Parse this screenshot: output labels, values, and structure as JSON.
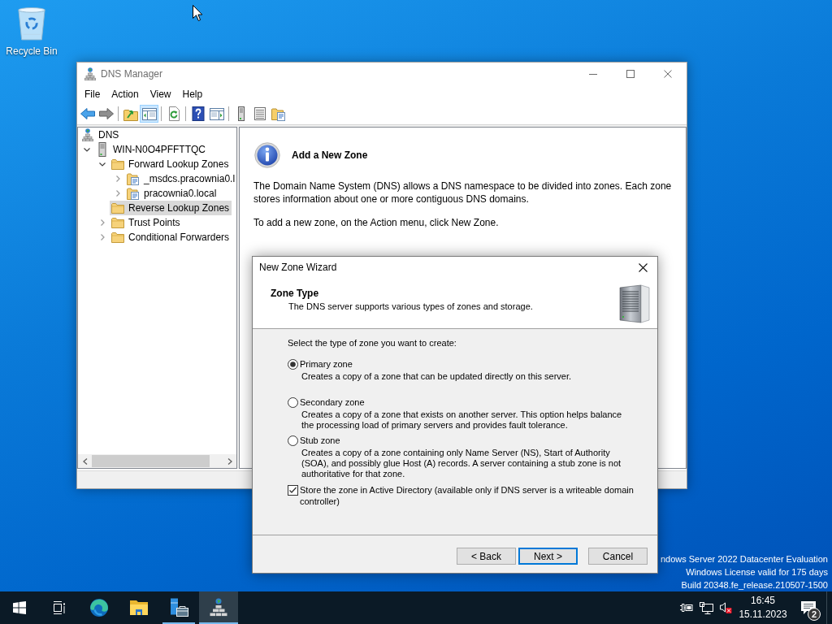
{
  "desktop": {
    "icons": [
      {
        "label": "Recycle Bin"
      }
    ],
    "edition_text": [
      "ndows Server 2022 Datacenter Evaluation",
      "Windows License valid for 175 days",
      "Build 20348.fe_release.210507-1500"
    ]
  },
  "dns_manager": {
    "title": "DNS Manager",
    "menu": [
      "File",
      "Action",
      "View",
      "Help"
    ],
    "toolbar": [
      [
        {
          "pressed": false
        },
        {
          "pressed": false
        }
      ],
      [
        {
          "pressed": false
        },
        {
          "pressed": true
        }
      ],
      [
        {
          "pressed": false
        }
      ],
      [
        {
          "pressed": false
        },
        {
          "pressed": false
        }
      ],
      [
        {
          "pressed": false
        },
        {
          "pressed": false
        },
        {
          "pressed": false
        }
      ]
    ],
    "tree": [
      {
        "label": "DNS",
        "kind": "dns",
        "selected": false,
        "children": [
          {
            "label": "WIN-N0O4PFFTTQC",
            "kind": "server",
            "expanded": true,
            "selected": false,
            "children": [
              {
                "label": "Forward Lookup Zones",
                "kind": "folder",
                "expanded": true,
                "selected": false,
                "children": [
                  {
                    "label": "_msdcs.pracownia0.l",
                    "kind": "zone",
                    "expanded": false,
                    "selected": false
                  },
                  {
                    "label": "pracownia0.local",
                    "kind": "zone",
                    "expanded": false,
                    "selected": false
                  }
                ]
              },
              {
                "label": "Reverse Lookup Zones",
                "kind": "folder",
                "selected": true
              },
              {
                "label": "Trust Points",
                "kind": "folder",
                "expanded": false,
                "selected": false
              },
              {
                "label": "Conditional Forwarders",
                "kind": "folder",
                "expanded": false,
                "selected": false
              }
            ]
          }
        ]
      }
    ],
    "content": {
      "heading": "Add a New Zone",
      "paragraphs": [
        "The Domain Name System (DNS) allows a DNS namespace to be divided into zones. Each zone stores information about one or more contiguous DNS domains.",
        "To add a new zone, on the Action menu, click New Zone."
      ]
    }
  },
  "wizard": {
    "title": "New Zone Wizard",
    "heading": "Zone Type",
    "subheading": "The DNS server supports various types of zones and storage.",
    "prompt": "Select the type of zone you want to create:",
    "options": [
      {
        "label": "Primary zone",
        "description": "Creates a copy of a zone that can be updated directly on this server.",
        "selected": true
      },
      {
        "label": "Secondary zone",
        "description": "Creates a copy of a zone that exists on another server. This option helps balance the processing load of primary servers and provides fault tolerance.",
        "selected": false
      },
      {
        "label": "Stub zone",
        "description": "Creates a copy of a zone containing only Name Server (NS), Start of Authority (SOA), and possibly glue Host (A) records. A server containing a stub zone is not authoritative for that zone.",
        "selected": false
      }
    ],
    "store_in_ad": {
      "label": "Store the zone in Active Directory (available only if DNS server is a writeable domain controller)",
      "checked": true
    },
    "buttons": [
      {
        "label": "< Back",
        "default": false
      },
      {
        "label": "Next >",
        "default": true
      },
      {
        "label": "Cancel",
        "default": false
      }
    ]
  },
  "taskbar": {
    "apps": [
      {
        "running": false,
        "active": false
      },
      {
        "running": false,
        "active": false
      },
      {
        "running": true,
        "active": false
      },
      {
        "running": true,
        "active": true
      }
    ],
    "clock": {
      "time": "16:45",
      "date": "15.11.2023"
    },
    "notification_count": "2"
  }
}
